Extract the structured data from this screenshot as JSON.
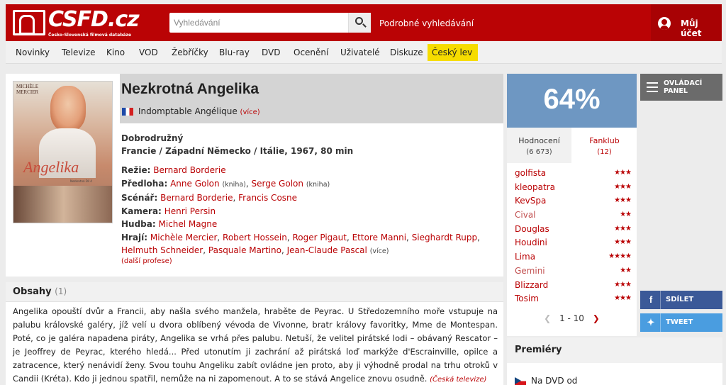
{
  "header": {
    "logo_text": "CSFD.cz",
    "logo_subtitle": "Česko-Slovenská filmová databáze",
    "search_placeholder": "Vyhledávání",
    "advanced_search": "Podrobné vyhledávání",
    "account": "Můj účet",
    "brand_color": "#ba0305"
  },
  "nav": {
    "items": [
      "Novinky",
      "Televize",
      "Kino",
      "VOD",
      "Žebříčky",
      "Blu-ray",
      "DVD",
      "Ocenění",
      "Uživatelé",
      "Diskuze",
      "Český lev"
    ]
  },
  "film": {
    "poster": {
      "actress": "MICHÈLE MERCIER",
      "title": "Angelika",
      "series": "Nezkrotná   Díl 4"
    },
    "title": "Nezkrotná Angelika",
    "original_title": "Indomptable Angélique",
    "original_more": "(více)",
    "genre": "Dobrodružný",
    "origin": "Francie / Západní Německo / Itálie, 1967, 80 min",
    "director_label": "Režie:",
    "director": "Bernard Borderie",
    "source_label": "Předloha:",
    "source_1": "Anne Golon",
    "source_1_note": "(kniha)",
    "source_2": "Serge Golon",
    "source_2_note": "(kniha)",
    "writer_label": "Scénář:",
    "writer_1": "Bernard Borderie",
    "writer_2": "Francis Cosne",
    "camera_label": "Kamera:",
    "camera": "Henri Persin",
    "music_label": "Hudba:",
    "music": "Michel Magne",
    "cast_label": "Hrají:",
    "cast": [
      "Michèle Mercier",
      "Robert Hossein",
      "Roger Pigaut",
      "Ettore Manni",
      "Sieghardt Rupp",
      "Helmuth Schneider",
      "Pasquale Martino",
      "Jean-Claude Pascal"
    ],
    "cast_more": "(více)",
    "other_professions": "(další profese)"
  },
  "plot": {
    "title": "Obsahy",
    "count": "(1)",
    "text": "Angelika opouští dvůr a Francii, aby našla svého manžela, hraběte de Peyrac. U Středozemního moře vstupuje na palubu královské galéry, jíž velí u dvora oblíbený vévoda de Vivonne, bratr královy favoritky, Mme de Montespan. Poté, co je galéra napadena piráty, Angelika se vrhá přes palubu. Netuší, že velitel pirátské lodi – obávaný Rescator – je Jeoffrey de Peyrac, kterého hledá... Před utonutím ji zachrání až pirátská loď markýže d'Escrainville, opilce a zatracence, který nenávidí ženy. Svou touhu Angeliku zabít ovládne jen proto, aby ji výhodně prodal na trhu otroků v Candii (Kréta). Kdo ji jednou spatřil, nemůže na ni zapomenout. A to se stává Angelice znovu osudně.",
    "source": "(Česká televize)"
  },
  "rating": {
    "value": "64%",
    "box_color": "#6e97c2",
    "tab_ratings": "Hodnocení",
    "tab_ratings_count": "(6 673)",
    "tab_fanclub": "Fanklub",
    "tab_fanclub_count": "(12)",
    "users": [
      {
        "name": "golfista",
        "stars": "★★★"
      },
      {
        "name": "kleopatra",
        "stars": "★★★"
      },
      {
        "name": "KevSpa",
        "stars": "★★★"
      },
      {
        "name": "Cival",
        "stars": "★★"
      },
      {
        "name": "Douglas",
        "stars": "★★★"
      },
      {
        "name": "Houdini",
        "stars": "★★★"
      },
      {
        "name": "Lima",
        "stars": "★★★★"
      },
      {
        "name": "Gemini",
        "stars": "★★"
      },
      {
        "name": "Blizzard",
        "stars": "★★★"
      },
      {
        "name": "Tosim",
        "stars": "★★★"
      }
    ],
    "pager": "1 - 10"
  },
  "sidebar": {
    "control_panel": "OVLÁDACÍ PANEL",
    "share": "SDÍLET",
    "tweet": "TWEET",
    "facebook_color": "#3b5998",
    "twitter_color": "#4a9de0"
  },
  "premieres": {
    "title": "Premiéry",
    "item": "Na DVD od"
  }
}
